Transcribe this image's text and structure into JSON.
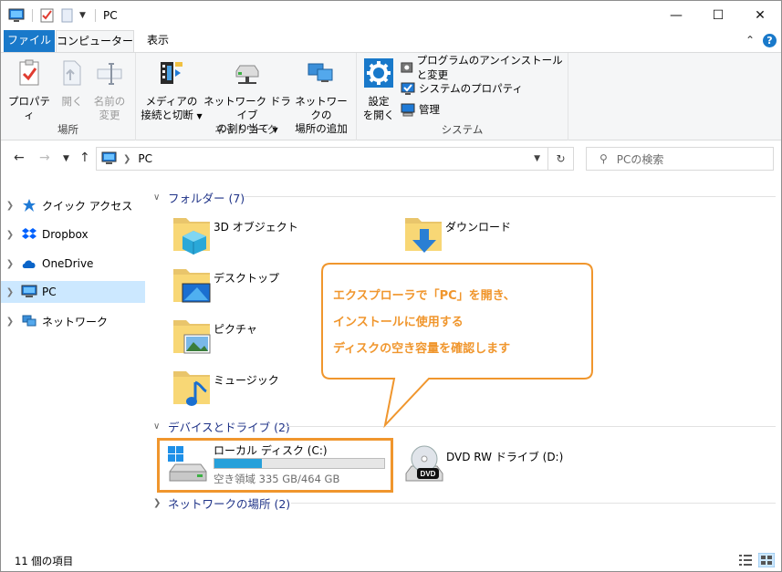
{
  "window": {
    "title": "PC",
    "minimize_glyph": "—",
    "maximize_glyph": "☐",
    "close_glyph": "✕"
  },
  "tabs": {
    "file": "ファイル",
    "computer": "コンピューター",
    "view": "表示",
    "collapse_glyph": "⌃",
    "help_glyph": "?"
  },
  "ribbon": {
    "location": {
      "label": "場所",
      "properties": "プロパティ",
      "open": "開く",
      "rename_line1": "名前の",
      "rename_line2": "変更"
    },
    "network": {
      "label": "ネットワーク",
      "media_line1": "メディアの",
      "media_line2": "接続と切断",
      "map_line1": "ネットワーク ドライブ",
      "map_line2": "の割り当て",
      "add_line1": "ネットワークの",
      "add_line2": "場所の追加"
    },
    "system": {
      "label": "システム",
      "settings_line1": "設定",
      "settings_line2": "を開く",
      "uninstall": "プログラムのアンインストールと変更",
      "properties": "システムのプロパティ",
      "manage": "管理"
    }
  },
  "addressbar": {
    "path": "PC",
    "search_placeholder": "PCの検索"
  },
  "navpane": {
    "items": [
      {
        "label": "クイック アクセス",
        "icon": "star-icon"
      },
      {
        "label": "Dropbox",
        "icon": "dropbox-icon"
      },
      {
        "label": "OneDrive",
        "icon": "cloud-icon"
      },
      {
        "label": "PC",
        "icon": "computer-icon",
        "selected": true
      },
      {
        "label": "ネットワーク",
        "icon": "network-icon"
      }
    ]
  },
  "content": {
    "folders_header": "フォルダー (7)",
    "folders": [
      {
        "name": "3D オブジェクト",
        "icon": "3d-objects-icon"
      },
      {
        "name": "ダウンロード",
        "icon": "download-folder-icon"
      },
      {
        "name": "デスクトップ",
        "icon": "desktop-folder-icon"
      },
      {
        "name": "ピクチャ",
        "icon": "pictures-folder-icon"
      },
      {
        "name": "ミュージック",
        "icon": "music-folder-icon"
      }
    ],
    "devices_header": "デバイスとドライブ (2)",
    "drive_c": {
      "name": "ローカル ディスク (C:)",
      "free": "空き領域 335 GB/464 GB",
      "used_fraction": 0.278
    },
    "drive_d": {
      "name": "DVD RW ドライブ (D:)",
      "badge": "DVD"
    },
    "network_header": "ネットワークの場所 (2)"
  },
  "callout": {
    "line1": "エクスプローラで「PC」を開き、",
    "line2": "インストールに使用する",
    "line3": "ディスクの空き容量を確認します",
    "color": "#f0962d"
  },
  "statusbar": {
    "count": "11 個の項目"
  }
}
